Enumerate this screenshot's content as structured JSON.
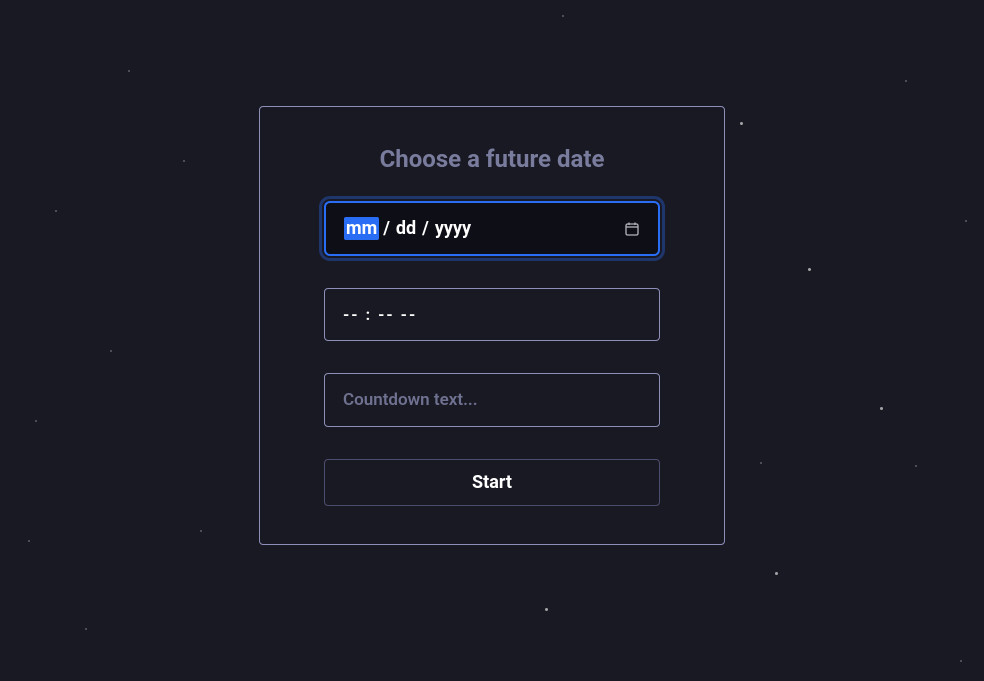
{
  "form": {
    "title": "Choose a future date",
    "date": {
      "month_segment": "mm",
      "day_segment": "dd",
      "year_segment": "yyyy",
      "separator": "/",
      "selected_segment": "month"
    },
    "time": {
      "display": "-- : --  --"
    },
    "countdown_text": {
      "placeholder": "Countdown text...",
      "value": ""
    },
    "submit_label": "Start"
  },
  "icons": {
    "calendar": "calendar-icon"
  },
  "colors": {
    "background": "#191923",
    "card_border": "#8d8fb9",
    "title": "#7a7c9e",
    "focus": "#2a6df5",
    "text": "#fefefe",
    "placeholder": "#6f7190"
  }
}
